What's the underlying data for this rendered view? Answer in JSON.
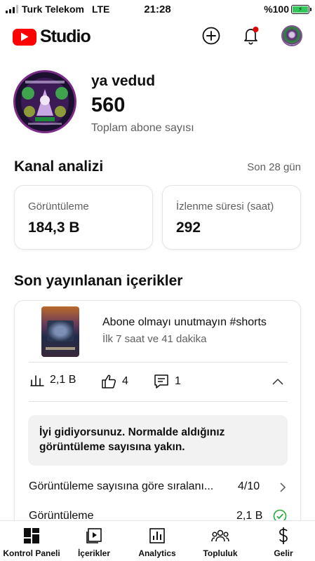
{
  "status_bar": {
    "carrier": "Turk Telekom",
    "network": "LTE",
    "time": "21:28",
    "battery": "%100"
  },
  "header": {
    "logo_text": "Studio",
    "icons": [
      "create-icon",
      "notifications-icon",
      "account-avatar"
    ],
    "accent_color": "#ff0000",
    "notification_dot_color": "#e10600"
  },
  "channel": {
    "name": "ya vedud",
    "subscriber_count": "560",
    "subscriber_label": "Toplam abone sayısı"
  },
  "analytics": {
    "title": "Kanal analizi",
    "period": "Son 28 gün",
    "cards": [
      {
        "label": "Görüntüleme",
        "value": "184,3 B"
      },
      {
        "label": "İzlenme süresi (saat)",
        "value": "292"
      }
    ]
  },
  "recent": {
    "title": "Son yayınlanan içerikler",
    "video": {
      "title": "Abone olmayı unutmayın #shorts",
      "subtitle": "İlk 7 saat ve 41 dakika",
      "views": "2,1 B",
      "likes": "4",
      "comments": "1"
    },
    "banner": "İyi gidiyorsunuz. Normalde aldığınız görüntüleme sayısına yakın.",
    "ranking_label": "Görüntüleme sayısına göre sıralanı...",
    "ranking_value": "4/10",
    "views_label": "Görüntüleme",
    "views_value": "2,1 B"
  },
  "nav": [
    {
      "label": "Kontrol Paneli",
      "icon": "dashboard-icon"
    },
    {
      "label": "İçerikler",
      "icon": "content-icon"
    },
    {
      "label": "Analytics",
      "icon": "analytics-icon"
    },
    {
      "label": "Topluluk",
      "icon": "community-icon"
    },
    {
      "label": "Gelir",
      "icon": "earn-icon"
    }
  ]
}
